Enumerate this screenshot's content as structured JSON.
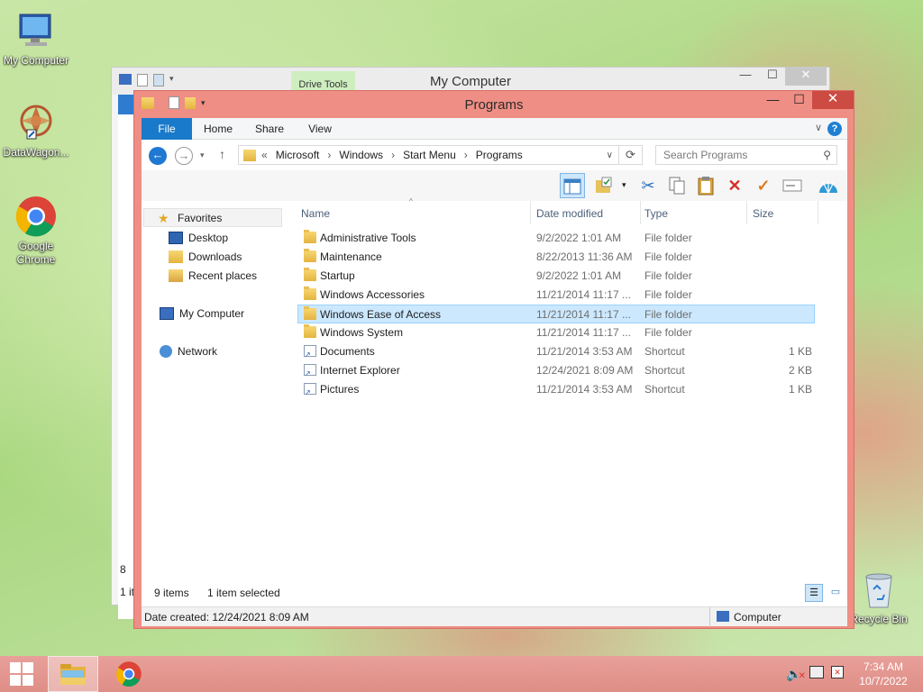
{
  "desktop": {
    "icons": [
      {
        "label": "My Computer",
        "icon": "computer-icon"
      },
      {
        "label": "DataWagon...",
        "icon": "datawagon-icon"
      },
      {
        "label": "Google Chrome",
        "icon": "chrome-icon"
      },
      {
        "label": "Recycle Bin",
        "icon": "recycle-bin-icon"
      }
    ]
  },
  "back_window": {
    "title": "My Computer",
    "drive_tools": "Drive Tools",
    "status_count": "1 it",
    "side_char": "8"
  },
  "window": {
    "title": "Programs",
    "tabs": [
      "File",
      "Home",
      "Share",
      "View"
    ],
    "address": {
      "overflow": "«",
      "crumbs": [
        "Microsoft",
        "Windows",
        "Start Menu",
        "Programs"
      ]
    },
    "search_placeholder": "Search Programs",
    "sidebar": {
      "favorites": "Favorites",
      "items": [
        "Desktop",
        "Downloads",
        "Recent places"
      ],
      "computer": "My Computer",
      "network": "Network"
    },
    "columns": [
      "Name",
      "Date modified",
      "Type",
      "Size"
    ],
    "rows": [
      {
        "name": "Administrative Tools",
        "date": "9/2/2022 1:01 AM",
        "type": "File folder",
        "size": "",
        "kind": "folder"
      },
      {
        "name": "Maintenance",
        "date": "8/22/2013 11:36 AM",
        "type": "File folder",
        "size": "",
        "kind": "folder"
      },
      {
        "name": "Startup",
        "date": "9/2/2022 1:01 AM",
        "type": "File folder",
        "size": "",
        "kind": "folder"
      },
      {
        "name": "Windows Accessories",
        "date": "11/21/2014 11:17 ...",
        "type": "File folder",
        "size": "",
        "kind": "folder"
      },
      {
        "name": "Windows Ease of Access",
        "date": "11/21/2014 11:17 ...",
        "type": "File folder",
        "size": "",
        "kind": "folder"
      },
      {
        "name": "Windows System",
        "date": "11/21/2014 11:17 ...",
        "type": "File folder",
        "size": "",
        "kind": "folder"
      },
      {
        "name": "Documents",
        "date": "11/21/2014 3:53 AM",
        "type": "Shortcut",
        "size": "1 KB",
        "kind": "shortcut"
      },
      {
        "name": "Internet Explorer",
        "date": "12/24/2021 8:09 AM",
        "type": "Shortcut",
        "size": "2 KB",
        "kind": "shortcut"
      },
      {
        "name": "Pictures",
        "date": "11/21/2014 3:53 AM",
        "type": "Shortcut",
        "size": "1 KB",
        "kind": "shortcut"
      }
    ],
    "selected_row": "Windows Ease of Access",
    "status": {
      "count": "9 items",
      "selected": "1 item selected"
    },
    "details": {
      "created": "Date created: 12/24/2021 8:09 AM",
      "location": "Computer"
    }
  },
  "taskbar": {
    "time": "7:34 AM",
    "date": "10/7/2022"
  }
}
